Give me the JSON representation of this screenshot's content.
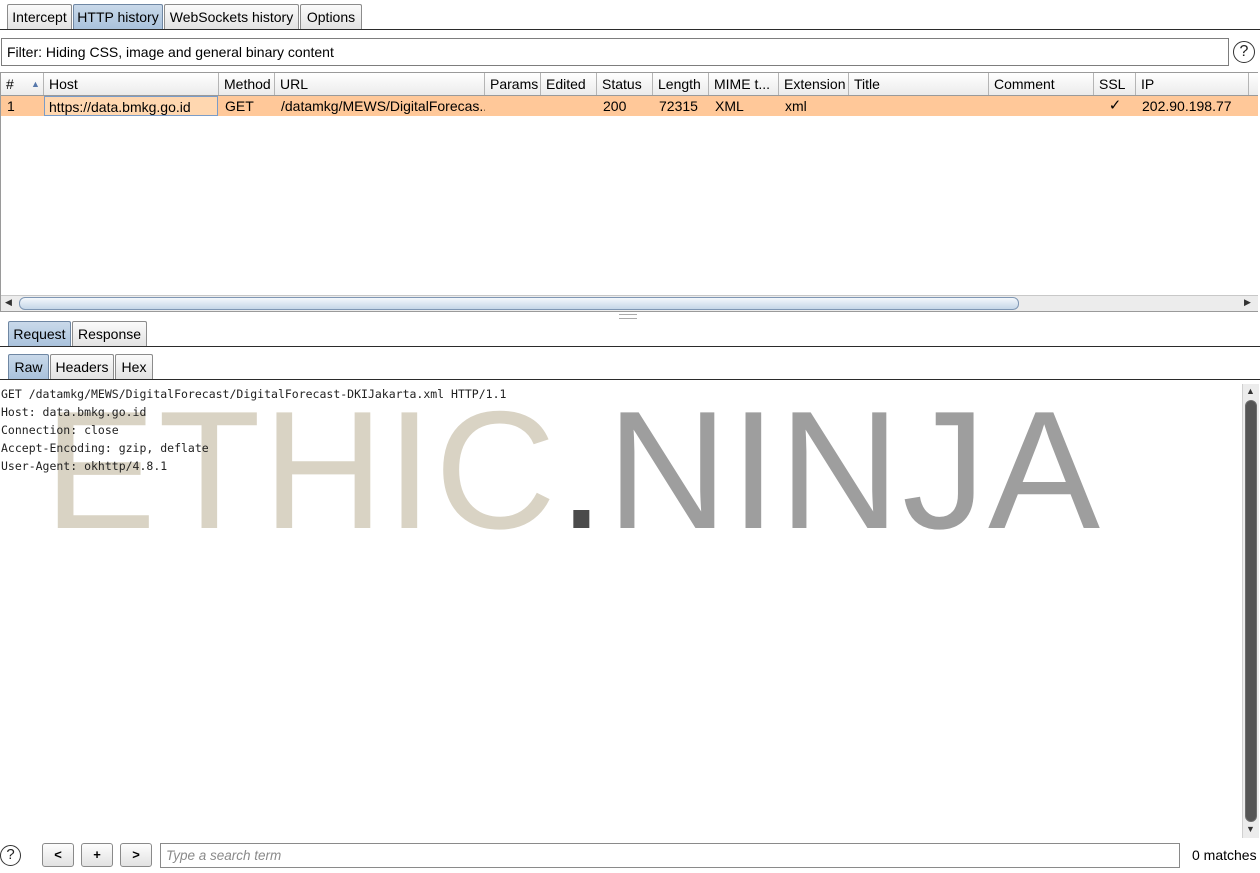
{
  "main_tabs": [
    {
      "label": "Intercept"
    },
    {
      "label": "HTTP history"
    },
    {
      "label": "WebSockets history"
    },
    {
      "label": "Options"
    }
  ],
  "filter": {
    "text": "Filter: Hiding CSS, image and general binary content",
    "help": "?"
  },
  "table": {
    "columns": [
      "#",
      "Host",
      "Method",
      "URL",
      "Params",
      "Edited",
      "Status",
      "Length",
      "MIME t...",
      "Extension",
      "Title",
      "Comment",
      "SSL",
      "IP"
    ],
    "sort_icon": "▲",
    "rows": [
      {
        "num": "1",
        "host": "https://data.bmkg.go.id",
        "method": "GET",
        "url": "/datamkg/MEWS/DigitalForecas...",
        "params": "",
        "edited": "",
        "status": "200",
        "length": "72315",
        "mime": "XML",
        "extension": "xml",
        "title": "",
        "comment": "",
        "ssl": "✓",
        "ip": "202.90.198.77"
      }
    ]
  },
  "message_tabs": [
    {
      "label": "Request"
    },
    {
      "label": "Response"
    }
  ],
  "view_tabs": [
    {
      "label": "Raw"
    },
    {
      "label": "Headers"
    },
    {
      "label": "Hex"
    }
  ],
  "raw_request": "GET /datamkg/MEWS/DigitalForecast/DigitalForecast-DKIJakarta.xml HTTP/1.1\nHost: data.bmkg.go.id\nConnection: close\nAccept-Encoding: gzip, deflate\nUser-Agent: okhttp/4.8.1",
  "watermark": {
    "part1": "ETHIC",
    "dot": ".",
    "part2": "NINJA"
  },
  "search": {
    "help": "?",
    "prev": "<",
    "add": "+",
    "next": ">",
    "placeholder": "Type a search term",
    "matches": "0 matches"
  },
  "colors": {
    "selected_row": "#ffc899",
    "active_tab": "#b5cbe2"
  }
}
